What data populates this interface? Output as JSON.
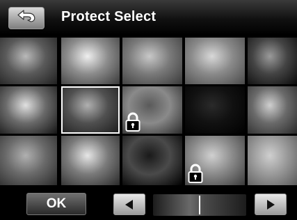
{
  "header": {
    "title": "Protect Select",
    "back_icon": "back-arrow-icon"
  },
  "grid": {
    "columns": 5,
    "rows": 3,
    "thumbnails": [
      {
        "name": "thumb-friends-group",
        "tone": [
          "#b9b9b9",
          "#5a5a5a",
          "#202020"
        ],
        "locked": false
      },
      {
        "name": "thumb-girl-jumping",
        "tone": [
          "#efefef",
          "#8c8c8c",
          "#3a3a3a"
        ],
        "locked": false
      },
      {
        "name": "thumb-two-children",
        "tone": [
          "#c8c8c8",
          "#7a7a7a",
          "#3a3a3a"
        ],
        "locked": false
      },
      {
        "name": "thumb-toddler-portrait",
        "tone": [
          "#d8d8d8",
          "#8a8a8a",
          "#4a4a4a"
        ],
        "locked": false
      },
      {
        "name": "thumb-city-skyline",
        "tone": [
          "#9a9a9a",
          "#444444",
          "#0a0a0a"
        ],
        "locked": false
      },
      {
        "name": "thumb-sunflower",
        "tone": [
          "#e0e0e0",
          "#6a6a6a",
          "#151515"
        ],
        "locked": false
      },
      {
        "name": "thumb-leaves",
        "tone": [
          "#b0b0b0",
          "#505050",
          "#1a1a1a"
        ],
        "locked": false
      },
      {
        "name": "thumb-beach-silhouette",
        "tone": [
          "#5a5a5a",
          "#8a8a8a",
          "#2a2a2a"
        ],
        "locked": true
      },
      {
        "name": "thumb-night-harbor",
        "tone": [
          "#2a2a2a",
          "#111111",
          "#000000"
        ],
        "locked": false
      },
      {
        "name": "thumb-boy-playing",
        "tone": [
          "#cfcfcf",
          "#6a6a6a",
          "#2a2a2a"
        ],
        "locked": false
      },
      {
        "name": "thumb-women-smiling",
        "tone": [
          "#b0b0b0",
          "#6a6a6a",
          "#2a2a2a"
        ],
        "locked": false
      },
      {
        "name": "thumb-woman-portrait",
        "tone": [
          "#e6e6e6",
          "#7a7a7a",
          "#2a2a2a"
        ],
        "locked": false
      },
      {
        "name": "thumb-night-highway",
        "tone": [
          "#1a1a1a",
          "#4a4a4a",
          "#000000"
        ],
        "locked": false
      },
      {
        "name": "thumb-couple-portrait",
        "tone": [
          "#d0d0d0",
          "#8a8a8a",
          "#3a3a3a"
        ],
        "locked": true
      },
      {
        "name": "thumb-toy-frog",
        "tone": [
          "#cfcfcf",
          "#9a9a9a",
          "#5a5a5a"
        ],
        "locked": false
      }
    ],
    "selected_index": 6
  },
  "footer": {
    "ok_label": "OK",
    "prev_icon": "left-arrow-icon",
    "next_icon": "right-arrow-icon"
  },
  "colors": {
    "background": "#000000",
    "title_text": "#ffffff",
    "button_light": "#d9d9d9",
    "button_dark": "#2a2a2a"
  }
}
